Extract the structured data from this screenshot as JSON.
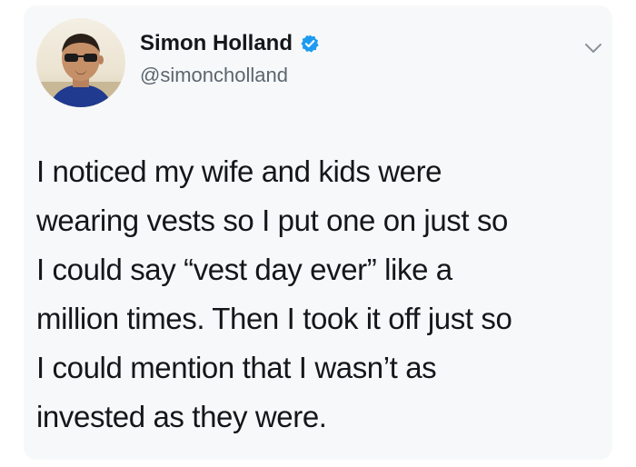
{
  "tweet": {
    "author": {
      "display_name": "Simon Holland",
      "handle": "@simoncholland",
      "verified_icon": "verified-badge-icon",
      "avatar": "avatar-photo"
    },
    "menu_icon": "chevron-down-icon",
    "text_lines": [
      "I noticed my wife and kids were",
      "wearing vests so I put one on just so",
      "I could say “vest day ever” like a",
      "million times. Then I took it off just so",
      "I could mention that I wasn’t as",
      "invested as they were."
    ]
  },
  "colors": {
    "card_background": "#f7f8f9",
    "verified_blue": "#1d9bf0",
    "handle_gray": "#5b6670",
    "text": "#14171a"
  }
}
